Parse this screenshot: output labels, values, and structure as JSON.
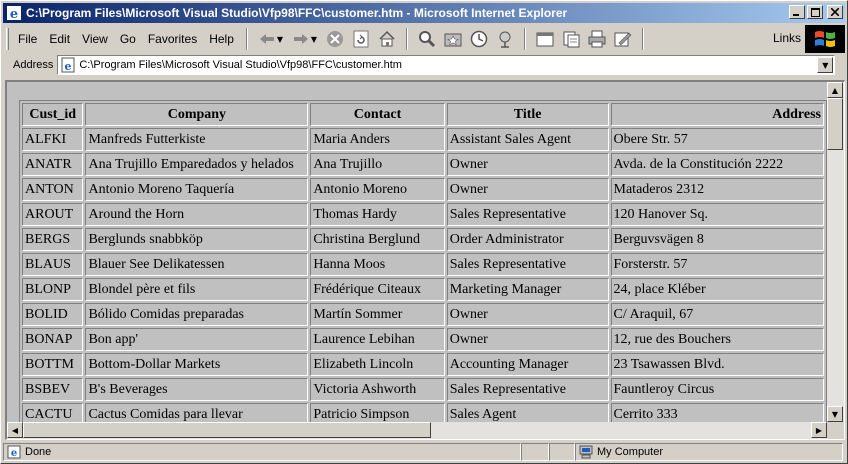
{
  "window": {
    "title": "C:\\Program Files\\Microsoft Visual Studio\\Vfp98\\FFC\\customer.htm - Microsoft Internet Explorer",
    "buttons": {
      "minimize": "_",
      "maximize": "□",
      "close": "✕"
    }
  },
  "menu": [
    {
      "label": "File"
    },
    {
      "label": "Edit"
    },
    {
      "label": "View"
    },
    {
      "label": "Go"
    },
    {
      "label": "Favorites"
    },
    {
      "label": "Help"
    }
  ],
  "toolbar": {
    "buttons": [
      "back-icon",
      "forward-icon",
      "stop-icon",
      "refresh-icon",
      "home-icon",
      "search-icon",
      "favorites-icon",
      "history-icon",
      "channels-icon",
      "fullscreen-icon",
      "mail-icon",
      "print-icon",
      "edit-icon"
    ],
    "links_label": "Links"
  },
  "address": {
    "label": "Address",
    "url": "C:\\Program Files\\Microsoft Visual Studio\\Vfp98\\FFC\\customer.htm"
  },
  "table": {
    "headers": [
      "Cust_id",
      "Company",
      "Contact",
      "Title",
      "Address"
    ],
    "rows": [
      [
        "ALFKI",
        "Manfreds Futterkiste",
        "Maria Anders",
        "Assistant Sales Agent",
        "Obere Str. 57"
      ],
      [
        "ANATR",
        "Ana Trujillo Emparedados y helados",
        "Ana Trujillo",
        "Owner",
        "Avda. de la Constitución 2222"
      ],
      [
        "ANTON",
        "Antonio Moreno Taquería",
        "Antonio Moreno",
        "Owner",
        "Mataderos  2312"
      ],
      [
        "AROUT",
        "Around the Horn",
        "Thomas Hardy",
        "Sales Representative",
        "120 Hanover Sq."
      ],
      [
        "BERGS",
        "Berglunds snabbköp",
        "Christina Berglund",
        "Order Administrator",
        "Berguvsvägen  8"
      ],
      [
        "BLAUS",
        "Blauer See Delikatessen",
        "Hanna Moos",
        "Sales Representative",
        "Forsterstr. 57"
      ],
      [
        "BLONP",
        "Blondel père et fils",
        "Frédérique Citeaux",
        "Marketing Manager",
        "24, place Kléber"
      ],
      [
        "BOLID",
        "Bólido Comidas preparadas",
        "Martín Sommer",
        "Owner",
        "C/ Araquil, 67"
      ],
      [
        "BONAP",
        "Bon app'",
        "Laurence Lebihan",
        "Owner",
        "12, rue des Bouchers"
      ],
      [
        "BOTTM",
        "Bottom-Dollar Markets",
        "Elizabeth Lincoln",
        "Accounting Manager",
        "23 Tsawassen Blvd."
      ],
      [
        "BSBEV",
        "B's Beverages",
        "Victoria Ashworth",
        "Sales Representative",
        "Fauntleroy Circus"
      ],
      [
        "CACTU",
        "Cactus Comidas para llevar",
        "Patricio Simpson",
        "Sales Agent",
        "Cerrito 333"
      ]
    ]
  },
  "status": {
    "text": "Done",
    "zone": "My Computer"
  }
}
